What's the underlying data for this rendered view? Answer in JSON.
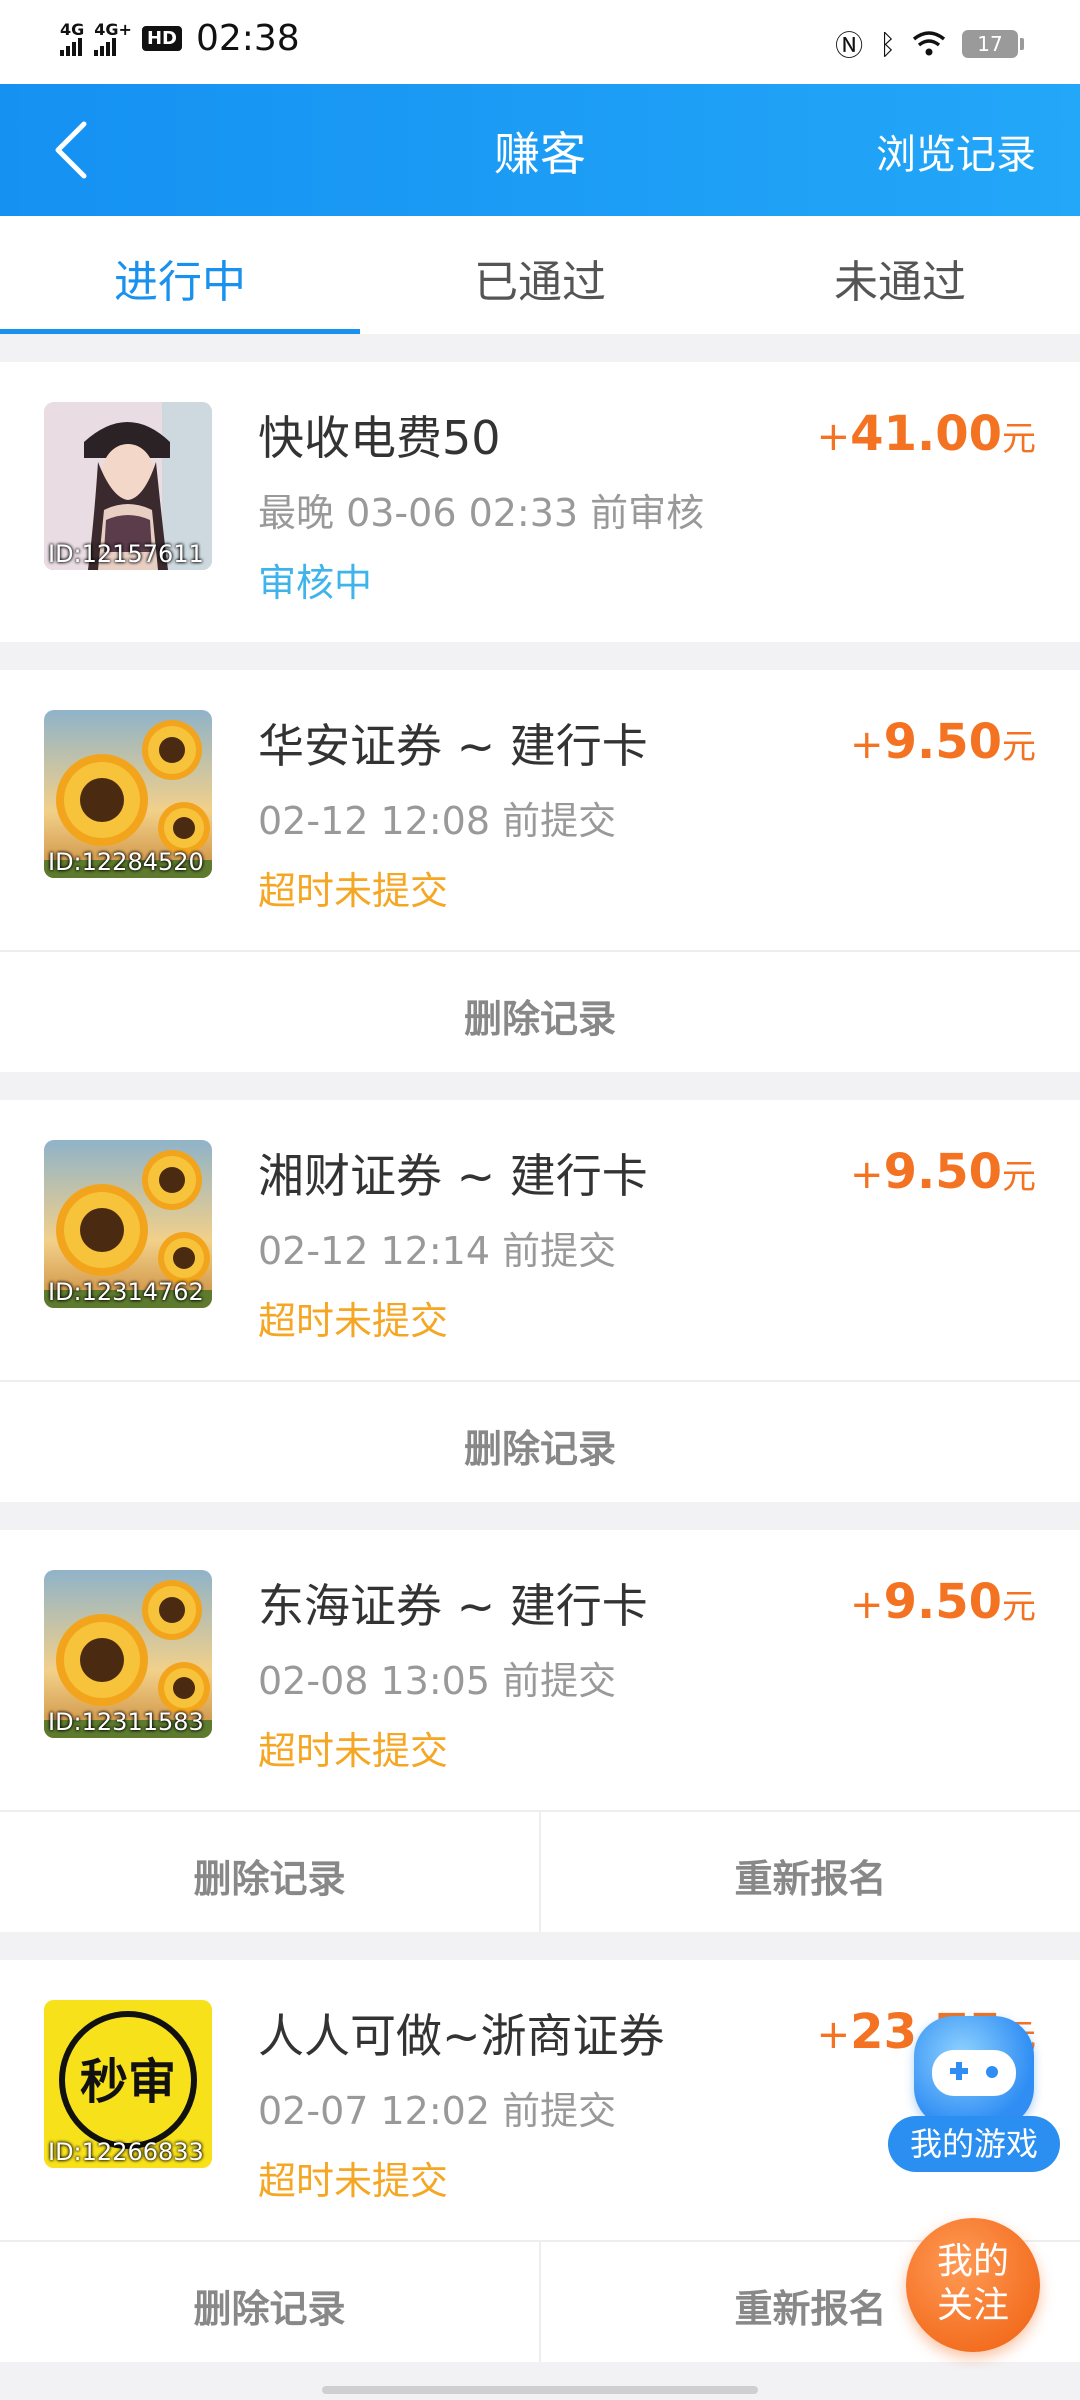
{
  "status_bar": {
    "net1": "4G",
    "net2": "4G+",
    "hd": "HD",
    "time": "02:38",
    "battery": "17"
  },
  "navbar": {
    "back_icon": "chevron-left-icon",
    "title": "赚客",
    "history_label": "浏览记录"
  },
  "tabs": [
    {
      "label": "进行中",
      "active": true
    },
    {
      "label": "已通过",
      "active": false
    },
    {
      "label": "未通过",
      "active": false
    }
  ],
  "tasks": [
    {
      "id_label": "ID:12157611",
      "title": "快收电费50",
      "time": "最晚 03-06 02:33 前审核",
      "status": "审核中",
      "status_color": "#3fb4ea",
      "reward_plus": "+",
      "reward_value": "41.00",
      "reward_unit": "元",
      "thumb": "portrait-photo"
    },
    {
      "id_label": "ID:12284520",
      "title": "华安证券 ~ 建行卡",
      "time": "02-12 12:08 前提交",
      "status": "超时未提交",
      "status_color": "#f5a623",
      "reward_plus": "+",
      "reward_value": "9.50",
      "reward_unit": "元",
      "thumb": "sunflower",
      "actions": [
        "删除记录"
      ]
    },
    {
      "id_label": "ID:12314762",
      "title": "湘财证券 ~ 建行卡",
      "time": "02-12 12:14 前提交",
      "status": "超时未提交",
      "status_color": "#f5a623",
      "reward_plus": "+",
      "reward_value": "9.50",
      "reward_unit": "元",
      "thumb": "sunflower",
      "actions": [
        "删除记录"
      ]
    },
    {
      "id_label": "ID:12311583",
      "title": "东海证券 ~ 建行卡",
      "time": "02-08 13:05 前提交",
      "status": "超时未提交",
      "status_color": "#f5a623",
      "reward_plus": "+",
      "reward_value": "9.50",
      "reward_unit": "元",
      "thumb": "sunflower",
      "actions": [
        "删除记录",
        "重新报名"
      ]
    },
    {
      "id_label": "ID:12266833",
      "title": "人人可做~浙商证券",
      "time": "02-07 12:02 前提交",
      "status": "超时未提交",
      "status_color": "#f5a623",
      "reward_plus": "+",
      "reward_value": "23.75",
      "reward_unit": "元",
      "thumb": "seal",
      "thumb_text": "秒审",
      "actions": [
        "删除记录",
        "重新报名"
      ]
    }
  ],
  "floating": {
    "game_label": "我的游戏",
    "game_icon": "gamepad-icon",
    "follow_label_line1": "我的",
    "follow_label_line2": "关注"
  },
  "colors": {
    "accent": "#1991ee",
    "reward": "#f37323",
    "status_pending": "#3fb4ea",
    "status_timeout": "#f5a623"
  }
}
